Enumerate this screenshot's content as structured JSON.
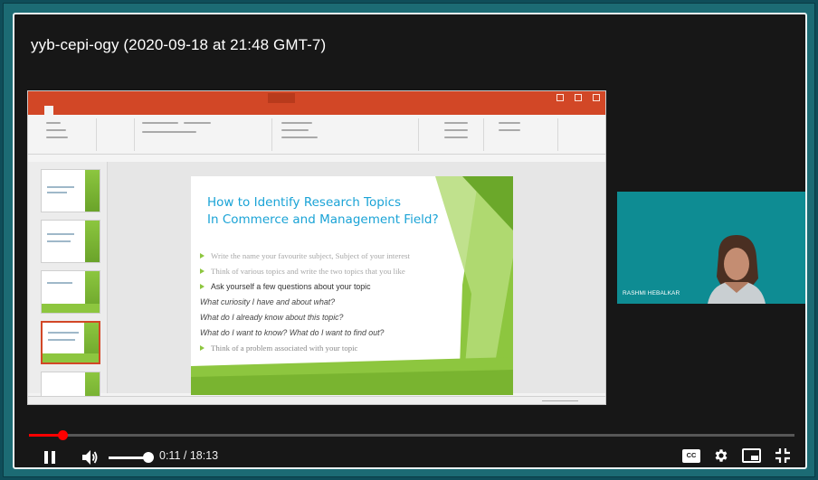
{
  "video": {
    "title": "yyb-cepi-ogy (2020-09-18 at 21:48 GMT-7)"
  },
  "slide": {
    "title_line1": "How to Identify Research Topics",
    "title_line2": "In Commerce and Management Field?",
    "bullets": [
      "Write the name your favourite subject, Subject of your interest",
      "Think of various topics and write the two topics that you like",
      "Ask yourself a few questions about your topic",
      "What curiosity I have and about what?",
      "What do I already know about this topic?",
      "What do I want to know? What do I want to find out?",
      "Think of a problem associated with your topic"
    ]
  },
  "webcam": {
    "participant_name": "RASHMI HEBALKAR"
  },
  "player": {
    "current_time": "0:11",
    "duration": "18:13",
    "time_display": "0:11 / 18:13",
    "progress_fraction": 0.0101,
    "volume_fraction": 1.0,
    "cc_label": "CC",
    "accent_color": "#ff0000"
  },
  "icons": {
    "play_pause": "pause-icon",
    "volume": "volume-icon",
    "subtitles": "closed-captions-icon",
    "settings": "gear-icon",
    "miniplayer": "miniplayer-icon",
    "fullscreen": "exit-fullscreen-icon"
  }
}
